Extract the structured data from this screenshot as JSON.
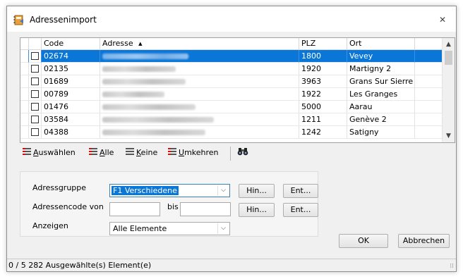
{
  "window": {
    "title": "Adressenimport",
    "close_glyph": "✕"
  },
  "grid": {
    "columns": [
      "Code",
      "Adresse",
      "PLZ",
      "Ort"
    ],
    "sort_indicator": "▲",
    "selected_row": 0,
    "rows": [
      {
        "code": "02674",
        "plz": "1800",
        "ort": "Vevey",
        "checked": false
      },
      {
        "code": "02135",
        "plz": "1920",
        "ort": "Martigny 2",
        "checked": false
      },
      {
        "code": "01689",
        "plz": "3963",
        "ort": "Grans Sur Sierre",
        "checked": false
      },
      {
        "code": "00789",
        "plz": "1922",
        "ort": "Les Granges",
        "checked": false
      },
      {
        "code": "01476",
        "plz": "5000",
        "ort": "Aarau",
        "checked": false
      },
      {
        "code": "03584",
        "plz": "1211",
        "ort": "Genève 2",
        "checked": false
      },
      {
        "code": "04388",
        "plz": "1242",
        "ort": "Satigny",
        "checked": false
      }
    ],
    "scroll_up": "▲",
    "scroll_down": "▼"
  },
  "toolbar": {
    "select_all_label_u": "A",
    "select_all_label_rest": "uswählen",
    "all_label_u": "A",
    "all_label_rest": "lle",
    "none_label_u": "K",
    "none_label_rest": "eine",
    "invert_label_u": "U",
    "invert_label_rest": "mkehren",
    "find_icon": "binoculars-icon"
  },
  "filters": {
    "group_label": "Adressgruppe",
    "group_value": "F1  Verschiedene",
    "code_label": "Adressencode von",
    "code_from": "",
    "bis_label": "bis",
    "code_to": "",
    "show_label": "Anzeigen",
    "show_value": "Alle Elemente",
    "hin_label": "Hin...",
    "ent_label": "Ent..."
  },
  "buttons": {
    "ok": "OK",
    "cancel": "Abbrechen"
  },
  "status": {
    "text": "0 / 5 282 Ausgewählte(s) Element(e)"
  },
  "colors": {
    "selection": "#0a76d8"
  }
}
